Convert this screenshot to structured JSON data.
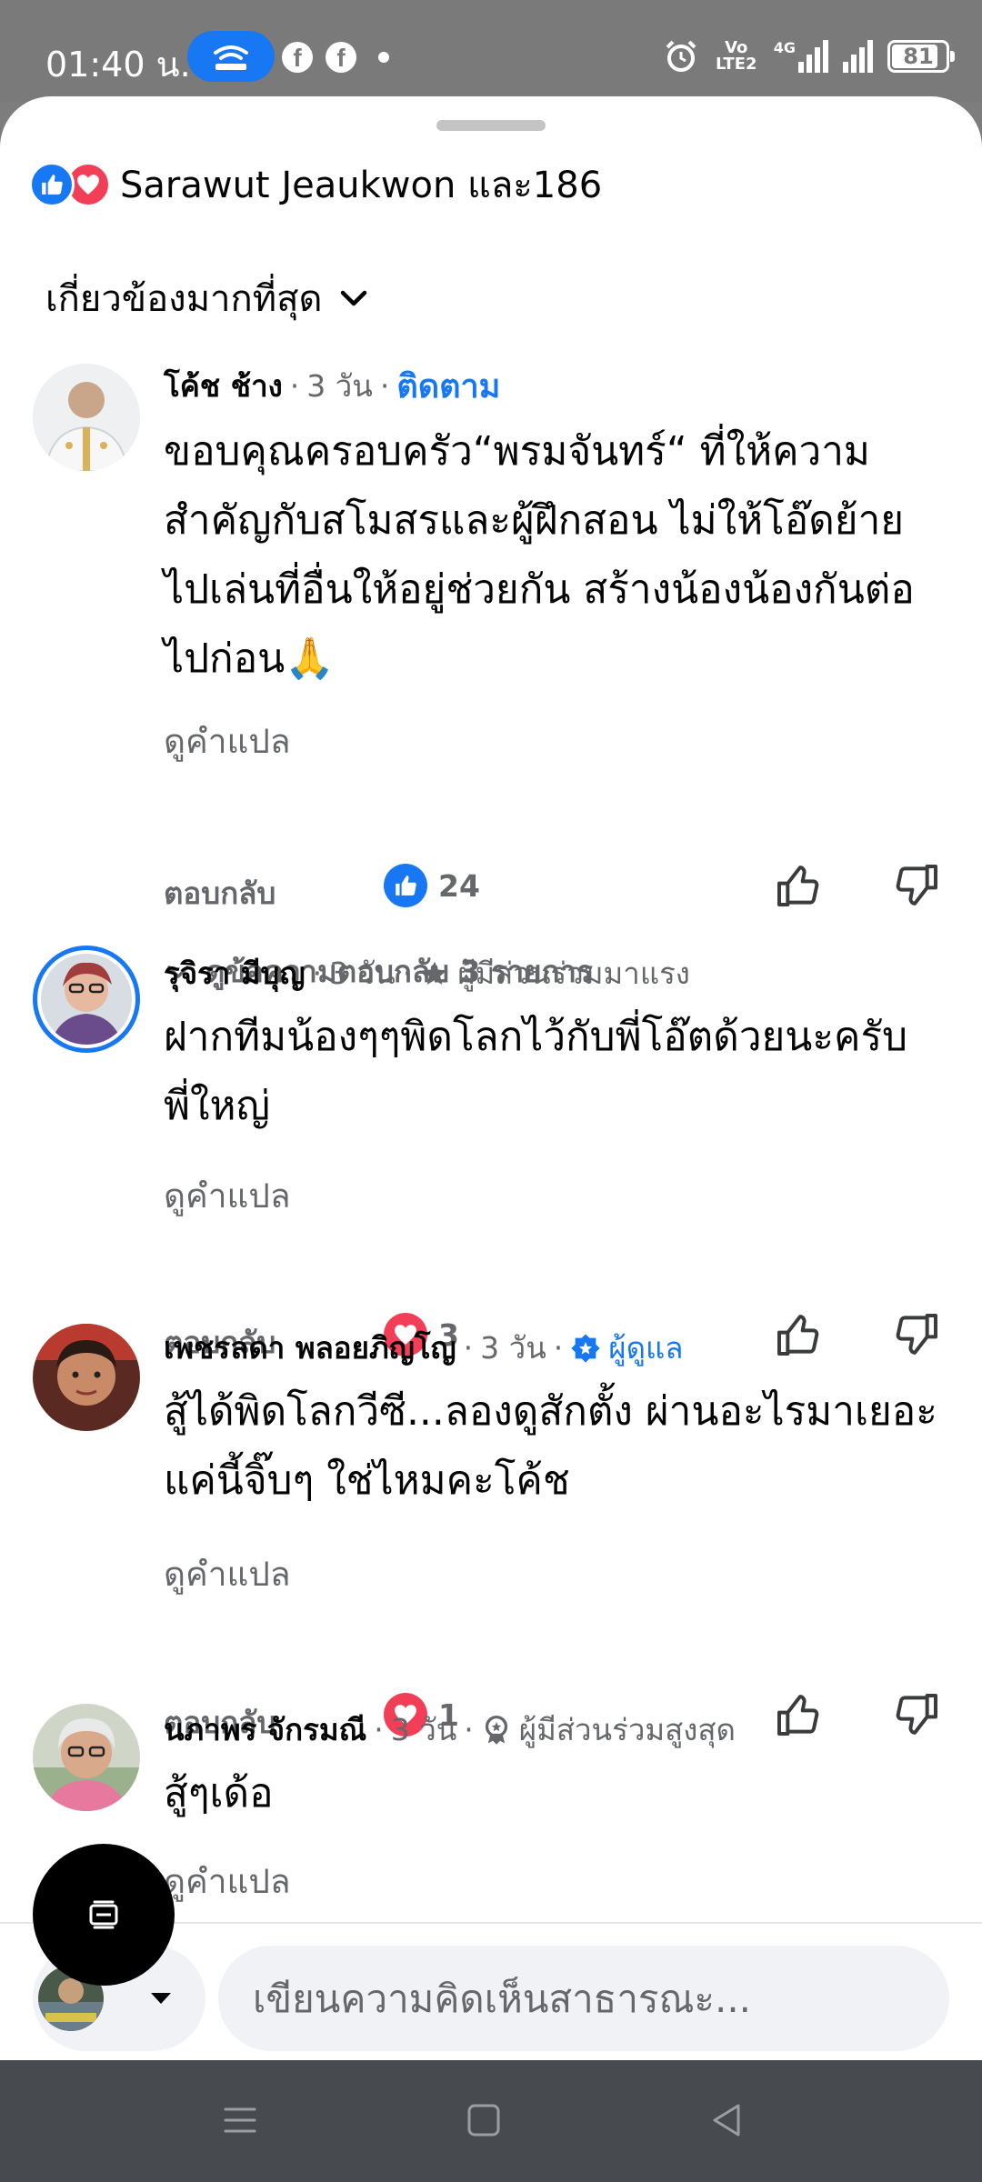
{
  "status_bar": {
    "time": "01:40 น.",
    "battery": "81",
    "battery_level": 0.81,
    "network": "4G",
    "volte": "Vo LTE2"
  },
  "reactions": {
    "summary": "Sarawut Jeaukwon และ186",
    "icons": [
      "like-icon",
      "love-icon"
    ]
  },
  "sort": {
    "label": "เกี่ยวข้องมากที่สุด"
  },
  "comments": [
    {
      "name": "โค้ช ช้าง",
      "time": "3 วัน",
      "extra": "ติดตาม",
      "text": "ขอบคุณครอบครัว“พรมจันทร์“ ที่ให้ความสำคัญกับสโมสรและผู้ฝึกสอน ไม่ให้โอ๊ดย้ายไปเล่นที่อื่นให้อยู่ช่วยกัน สร้างน้องน้องกันต่อไปก่อน🙏￼",
      "see_translation": "ดูคำแปล",
      "reply": "ตอบกลับ",
      "reaction_type": "like",
      "reaction_count": "24",
      "view_replies": "ดูข้อความตอบกลับ 3 รายการ"
    },
    {
      "name": "รุจิรา มีบุญ",
      "time": "3 วัน",
      "badge": "ผู้มีส่วนร่วมมาแรง",
      "text": "ฝากทีมน้องๆๆพิดโลกไว้กับพี่โอ๊ตด้วยนะครับ พี่ใหญ่",
      "see_translation": "ดูคำแปล",
      "reply": "ตอบกลับ",
      "reaction_type": "love",
      "reaction_count": "3"
    },
    {
      "name": "เพชรลดา พลอยภิญโญ",
      "time": "3 วัน",
      "badge": "ผู้ดูแล",
      "text": "สู้ได้พิดโลกวีซี...ลองดูสักตั้ง ผ่านอะไรมาเยอะ แค่นี้จิ๊บๆ ใช่ไหมคะโค้ช",
      "see_translation": "ดูคำแปล",
      "reply": "ตอบกลับ",
      "reaction_type": "love",
      "reaction_count": "1"
    },
    {
      "name": "นภาพร จักรมณี",
      "time": "3 วัน",
      "badge": "ผู้มีส่วนร่วมสูงสุด",
      "text": "สู้ๆเด้อ",
      "see_translation": "ดูคำแปล"
    }
  ],
  "composer": {
    "placeholder": "เขียนความคิดเห็นสาธารณะ..."
  },
  "colors": {
    "facebook_blue": "#1877f2",
    "love_red": "#f33e58",
    "secondary_text": "#65676b"
  }
}
